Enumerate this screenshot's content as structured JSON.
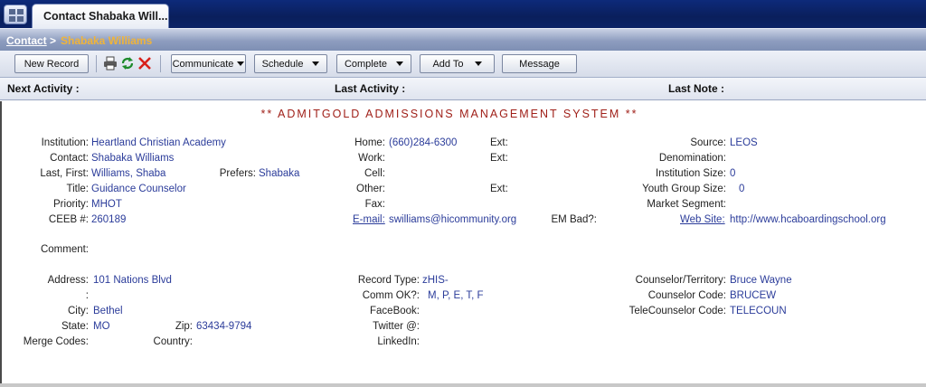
{
  "tabs": {
    "active_label": "Contact Shabaka Will..."
  },
  "breadcrumb": {
    "root": "Contact",
    "separator": ">",
    "current": "Shabaka Williams"
  },
  "toolbar": {
    "new_record": "New Record",
    "communicate": "Communicate",
    "schedule": "Schedule",
    "complete": "Complete",
    "add_to": "Add To",
    "message": "Message"
  },
  "activity": {
    "next_activity": "Next Activity :",
    "last_activity": "Last Activity :",
    "last_note": "Last Note :"
  },
  "banner": "** ADMITGOLD ADMISSIONS MANAGEMENT SYSTEM **",
  "left": {
    "institution_label": "Institution:",
    "institution": "Heartland Christian Academy",
    "contact_label": "Contact:",
    "contact": "Shabaka Williams",
    "lastfirst_label": "Last, First:",
    "lastfirst": "Williams, Shaba",
    "prefers_label": "Prefers:",
    "prefers": "Shabaka",
    "title_label": "Title:",
    "title": "Guidance Counselor",
    "priority_label": "Priority:",
    "priority": "MHOT",
    "ceeb_label": "CEEB #:",
    "ceeb": "260189",
    "comment_label": "Comment:"
  },
  "middle": {
    "home_label": "Home:",
    "home": "(660)284-6300",
    "home_ext": "Ext:",
    "work_label": "Work:",
    "work_ext": "Ext:",
    "cell_label": "Cell:",
    "other_label": "Other:",
    "other_ext": "Ext:",
    "fax_label": "Fax:",
    "email_label": "E-mail:",
    "email": "swilliams@hicommunity.org",
    "embad_label": "EM Bad?:"
  },
  "right": {
    "source_label": "Source:",
    "source": "LEOS",
    "denomination_label": "Denomination:",
    "inst_size_label": "Institution Size:",
    "inst_size": "0",
    "youth_label": "Youth Group Size:",
    "youth": "0",
    "market_label": "Market Segment:",
    "website_label": "Web Site:",
    "website": "http://www.hcaboardingschool.org"
  },
  "address": {
    "address_label": "Address:",
    "address": "101 Nations Blvd",
    "address2_label": ":",
    "city_label": "City:",
    "city": "Bethel",
    "state_label": "State:",
    "state": "MO",
    "zip_label": "Zip:",
    "zip": "63434-9794",
    "merge_label": "Merge Codes:",
    "country_label": "Country:"
  },
  "record": {
    "type_label": "Record Type:",
    "type": "zHIS-",
    "commok_label": "Comm OK?:",
    "commok": "M, P, E, T, F",
    "facebook_label": "FaceBook:",
    "twitter_label": "Twitter @:",
    "linkedin_label": "LinkedIn:"
  },
  "counselor": {
    "territory_label": "Counselor/Territory:",
    "territory": "Bruce Wayne",
    "code_label": "Counselor Code:",
    "code": "BRUCEW",
    "tele_label": "TeleCounselor Code:",
    "tele": "TELECOUN"
  },
  "colors": {
    "link": "#2b3c9a",
    "banner": "#a0211a",
    "crumb_current": "#f0b43a",
    "tabbar": "#0a1f5c"
  },
  "icons": [
    "grid-icon",
    "printer-icon",
    "refresh-icon",
    "delete-icon",
    "caret-down-icon"
  ]
}
